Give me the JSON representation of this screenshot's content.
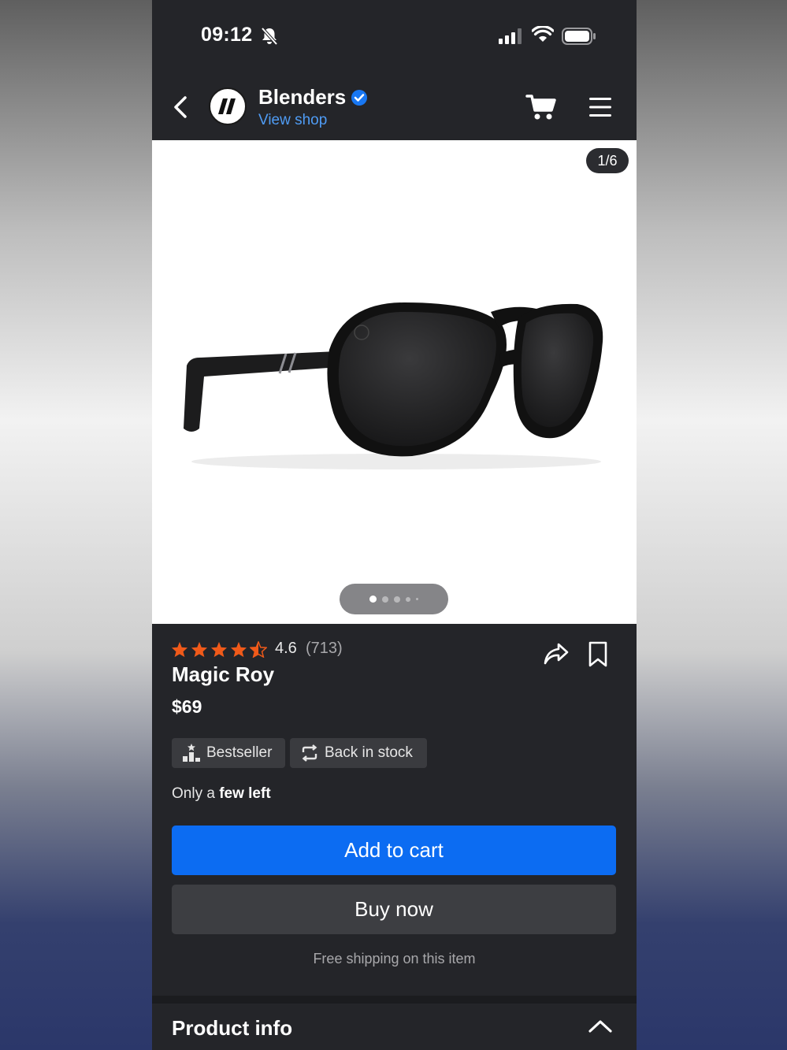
{
  "status_bar": {
    "time": "09:12"
  },
  "header": {
    "shop_name": "Blenders",
    "view_shop_label": "View shop",
    "icons": [
      "back-icon",
      "verified-icon",
      "cart-icon",
      "menu-icon"
    ]
  },
  "gallery": {
    "counter": "1/6",
    "current_index": 1,
    "total_images": 6
  },
  "product": {
    "rating_value": "4.6",
    "rating_count": "(713)",
    "title": "Magic Roy",
    "price": "$69",
    "badges": [
      {
        "label": "Bestseller",
        "icon": "bestseller-icon"
      },
      {
        "label": "Back in stock",
        "icon": "restock-icon"
      }
    ],
    "stock_prefix": "Only a",
    "stock_emphasis": "few left",
    "add_to_cart_label": "Add to cart",
    "buy_now_label": "Buy now",
    "shipping_note": "Free shipping on this item"
  },
  "product_info": {
    "title": "Product info"
  },
  "colors": {
    "accent_blue": "#0c6cf2",
    "link_blue": "#4f9cf5",
    "star_orange": "#f05a1a",
    "background_dark": "#242529"
  }
}
